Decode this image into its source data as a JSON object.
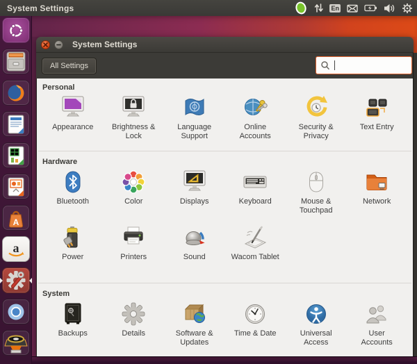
{
  "menu_bar": {
    "app_title": "System Settings",
    "keyboard_layout": "En"
  },
  "tray": {
    "icons": [
      "status-blob",
      "network-arrows",
      "keyboard-layout",
      "messages-envelope",
      "battery",
      "volume",
      "session-gear"
    ]
  },
  "launcher": {
    "items": [
      "ubuntu-dash",
      "files",
      "firefox",
      "libreoffice-writer",
      "libreoffice-calc",
      "libreoffice-impress",
      "ubuntu-software-center",
      "amazon",
      "system-settings",
      "chromium",
      "music-player"
    ],
    "software_center_letter": "A",
    "amazon_letter": "a"
  },
  "window": {
    "title": "System Settings",
    "toolbar": {
      "all_settings": "All Settings",
      "search_value": ""
    },
    "sections": [
      {
        "title": "Personal",
        "items": [
          {
            "label": "Appearance"
          },
          {
            "label": "Brightness &\nLock"
          },
          {
            "label": "Language\nSupport"
          },
          {
            "label": "Online\nAccounts"
          },
          {
            "label": "Security &\nPrivacy"
          },
          {
            "label": "Text Entry"
          }
        ]
      },
      {
        "title": "Hardware",
        "items": [
          {
            "label": "Bluetooth"
          },
          {
            "label": "Color"
          },
          {
            "label": "Displays"
          },
          {
            "label": "Keyboard"
          },
          {
            "label": "Mouse &\nTouchpad"
          },
          {
            "label": "Network"
          },
          {
            "label": "Power"
          },
          {
            "label": "Printers"
          },
          {
            "label": "Sound"
          },
          {
            "label": "Wacom Tablet"
          }
        ]
      },
      {
        "title": "System",
        "items": [
          {
            "label": "Backups"
          },
          {
            "label": "Details"
          },
          {
            "label": "Software &\nUpdates"
          },
          {
            "label": "Time & Date"
          },
          {
            "label": "Universal\nAccess"
          },
          {
            "label": "User\nAccounts"
          }
        ]
      }
    ]
  },
  "colors": {
    "accent_orange": "#dd4814",
    "panel": "#3c3b37",
    "content_bg": "#f1f0ee",
    "search_border": "#e0622e"
  }
}
